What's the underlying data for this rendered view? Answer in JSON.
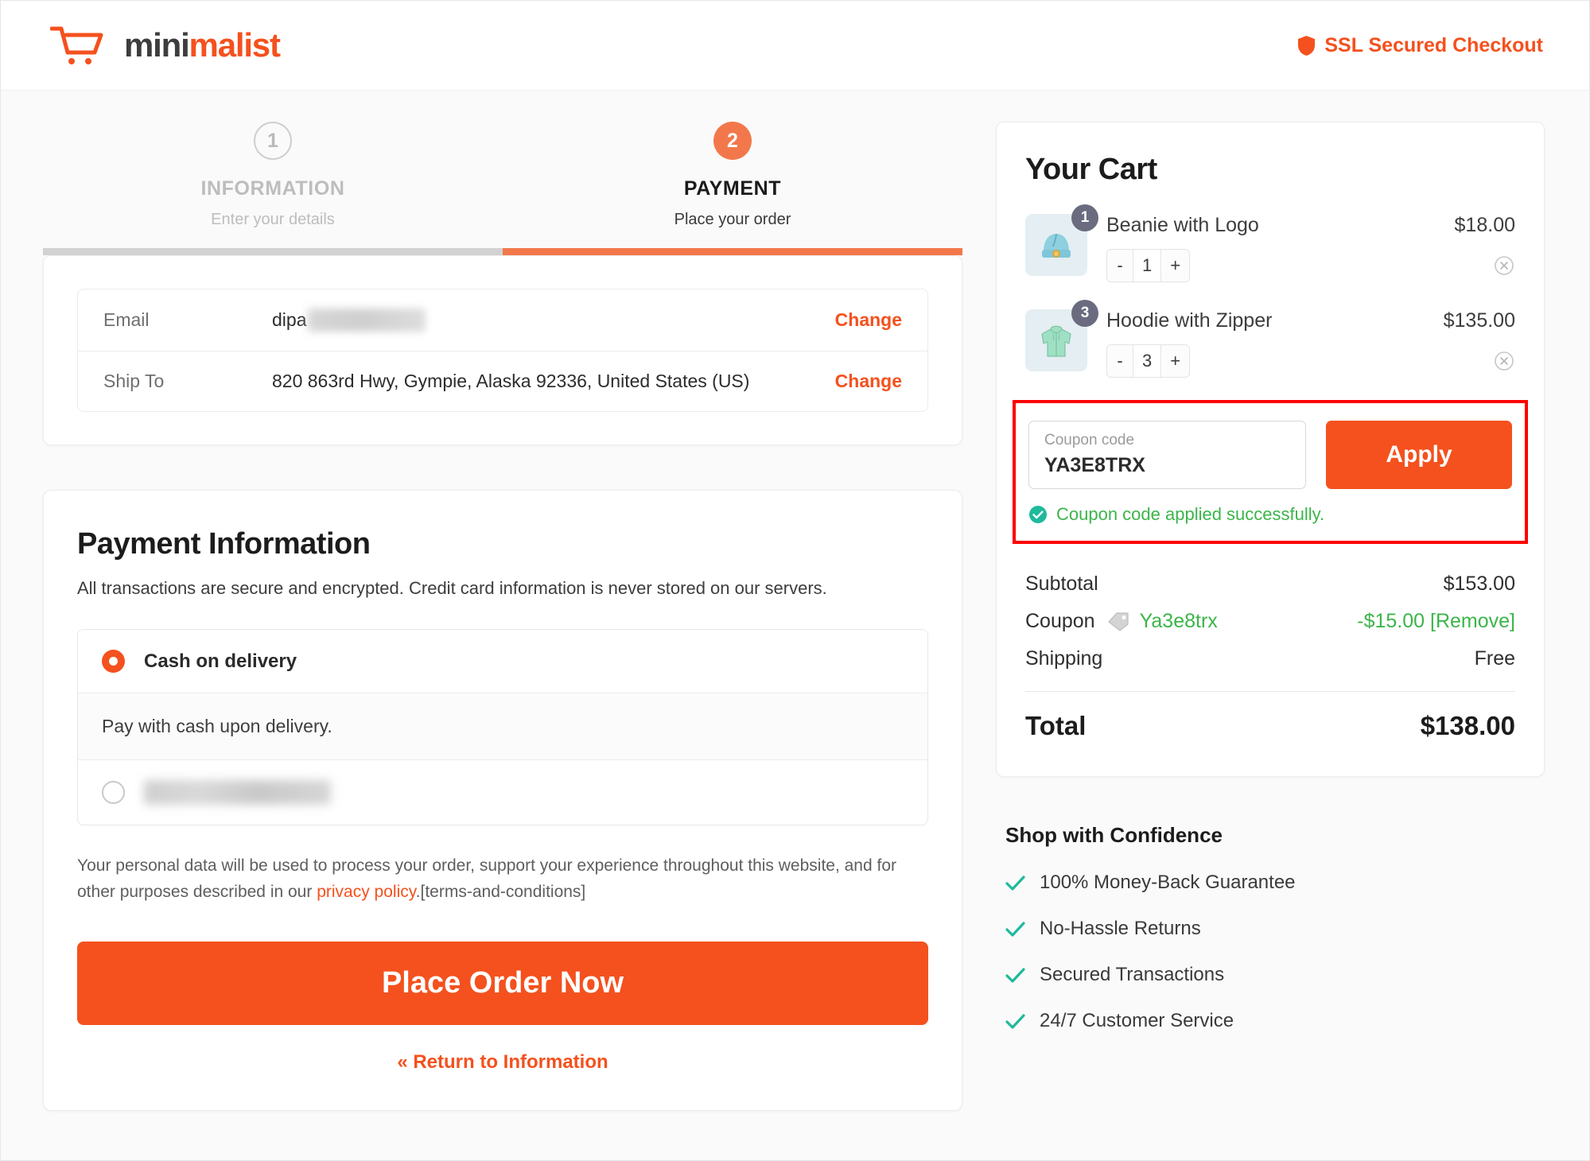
{
  "brand": {
    "cart_icon": "shopping-cart-icon",
    "name_part1": "mini",
    "name_part2": "malist"
  },
  "header": {
    "ssl_icon": "shield-icon",
    "ssl_text": "SSL Secured Checkout"
  },
  "steps": [
    {
      "number": "1",
      "title": "INFORMATION",
      "subtitle": "Enter your details",
      "state": "inactive"
    },
    {
      "number": "2",
      "title": "PAYMENT",
      "subtitle": "Place your order",
      "state": "active"
    }
  ],
  "order_summary": {
    "email_label": "Email",
    "email_value": "dipa",
    "email_redacted": true,
    "email_change": "Change",
    "ship_label": "Ship To",
    "ship_value": "820 863rd Hwy, Gympie, Alaska 92336, United States (US)",
    "ship_change": "Change"
  },
  "payment": {
    "title": "Payment Information",
    "subtitle": "All transactions are secure and encrypted. Credit card information is never stored on our servers.",
    "method_selected_label": "Cash on delivery",
    "method_selected_desc": "Pay with cash upon delivery.",
    "method_second_redacted": true,
    "privacy_text_before": "Your personal data will be used to process your order, support your experience throughout this website, and for other purposes described in our ",
    "privacy_link": "privacy policy",
    "privacy_text_after": ".[terms-and-conditions]",
    "place_order_label": "Place Order Now",
    "return_link": "« Return to Information"
  },
  "cart": {
    "title": "Your Cart",
    "items": [
      {
        "badge": "1",
        "name": "Beanie with Logo",
        "price": "$18.00",
        "qty": "1",
        "minus": "-",
        "plus": "+",
        "thumb_icon": "beanie-icon",
        "remove_icon": "remove-item-icon"
      },
      {
        "badge": "3",
        "name": "Hoodie with Zipper",
        "price": "$135.00",
        "qty": "3",
        "minus": "-",
        "plus": "+",
        "thumb_icon": "hoodie-icon",
        "remove_icon": "remove-item-icon"
      }
    ],
    "coupon": {
      "field_label": "Coupon code",
      "field_value": "YA3E8TRX",
      "apply_label": "Apply",
      "success_icon": "check-circle-icon",
      "success_message": "Coupon code applied successfully."
    },
    "totals": {
      "subtotal_label": "Subtotal",
      "subtotal_value": "$153.00",
      "coupon_label": "Coupon",
      "coupon_icon": "price-tag-icon",
      "coupon_code": "Ya3e8trx",
      "coupon_amount": "-$15.00",
      "coupon_remove": "[Remove]",
      "shipping_label": "Shipping",
      "shipping_value": "Free",
      "total_label": "Total",
      "total_value": "$138.00"
    }
  },
  "confidence": {
    "title": "Shop with Confidence",
    "items": [
      "100% Money-Back Guarantee",
      "No-Hassle Returns",
      "Secured Transactions",
      "24/7 Customer Service"
    ]
  },
  "colors": {
    "accent": "#f4511e",
    "step_active": "#f2784b",
    "success": "#3cb54a",
    "check_teal": "#1fb99b",
    "highlight": "#ff0000",
    "badge": "#6b6b80"
  }
}
